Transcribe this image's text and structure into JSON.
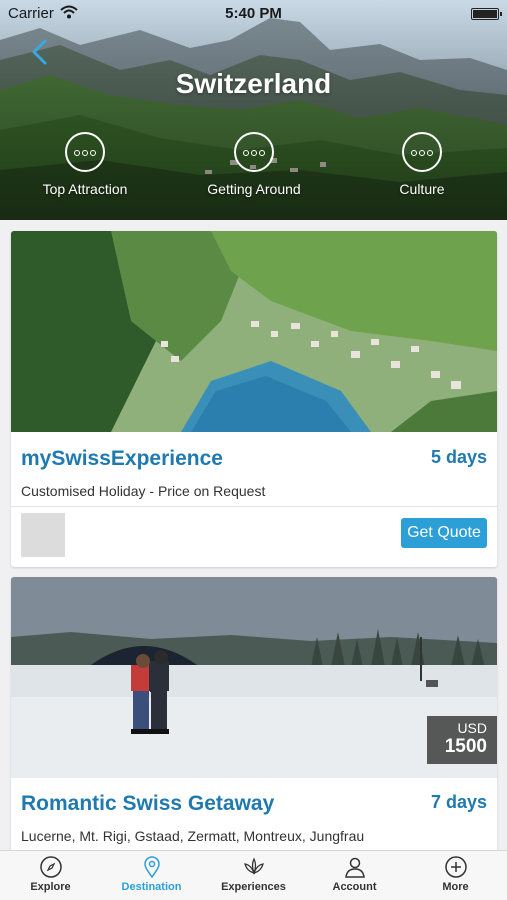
{
  "status_bar": {
    "carrier": "Carrier",
    "time": "5:40 PM"
  },
  "header": {
    "title": "Switzerland"
  },
  "categories": [
    {
      "label": "Top Attraction",
      "icon": "ellipsis-circle-icon"
    },
    {
      "label": "Getting Around",
      "icon": "ellipsis-circle-icon"
    },
    {
      "label": "Culture",
      "icon": "ellipsis-circle-icon"
    }
  ],
  "packages": [
    {
      "title": "mySwissExperience",
      "duration": "5 days",
      "subtitle": "Customised Holiday - Price on Request",
      "button": "Get Quote"
    },
    {
      "title": "Romantic Swiss Getaway",
      "duration": "7 days",
      "subtitle": "Lucerne, Mt. Rigi, Gstaad, Zermatt, Montreux, Jungfrau",
      "price_currency": "USD",
      "price_amount": "1500"
    }
  ],
  "tabs": [
    {
      "label": "Explore",
      "icon": "compass-icon",
      "active": false
    },
    {
      "label": "Destination",
      "icon": "map-pin-icon",
      "active": true
    },
    {
      "label": "Experiences",
      "icon": "lotus-icon",
      "active": false
    },
    {
      "label": "Account",
      "icon": "person-icon",
      "active": false
    },
    {
      "label": "More",
      "icon": "plus-circle-icon",
      "active": false
    }
  ],
  "colors": {
    "accent": "#2b9fd6",
    "title_blue": "#1f7ab0",
    "price_tag_bg": "#3c3c3c"
  }
}
